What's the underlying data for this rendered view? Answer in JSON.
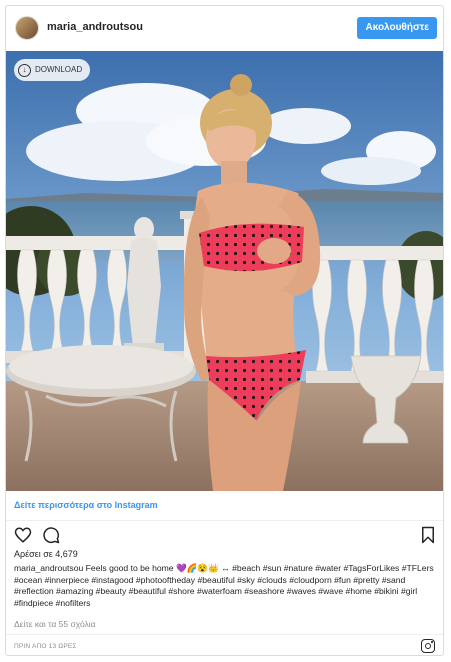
{
  "header": {
    "username": "maria_androutsou",
    "follow_label": "Ακολουθήστε"
  },
  "photo": {
    "download_label": "DOWNLOAD"
  },
  "see_more": "Δείτε περισσότερα στο Instagram",
  "likes": "Αρέσει σε 4,679",
  "caption": {
    "username": "maria_androutsou",
    "text": "Feels good to be home 💜🌈😵👑 ↔ #beach #sun #nature #water #TagsForLikes #TFLers #ocean #innerpiece #instagood #photooftheday #beautiful #sky #clouds #cloudporn #fun #pretty #sand #reflection #amazing #beauty #beautiful #shore #waterfoam #seashore #waves #wave #home #bikini #girl #findpiece #nofilters"
  },
  "comments": "Δείτε και τα 55 σχόλια",
  "timestamp": "ΠΡΙΝ ΑΠΟ 13 ΩΡΕΣ",
  "icons": {
    "like": "heart-icon",
    "comment": "comment-icon",
    "save": "bookmark-icon",
    "instagram": "instagram-icon",
    "download": "download-icon"
  }
}
